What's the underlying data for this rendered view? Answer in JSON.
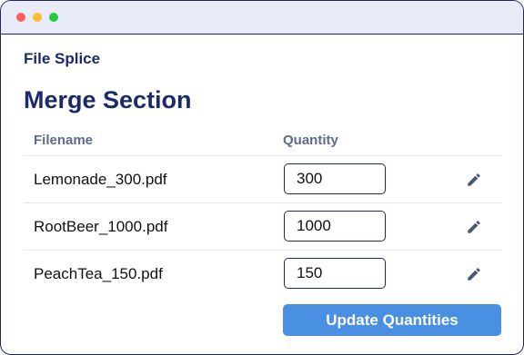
{
  "window": {
    "controls": [
      "close",
      "minimize",
      "maximize"
    ]
  },
  "app": {
    "title": "File Splice"
  },
  "section": {
    "title": "Merge Section"
  },
  "table": {
    "columns": {
      "filename": "Filename",
      "quantity": "Quantity"
    },
    "rows": [
      {
        "filename": "Lemonade_300.pdf",
        "quantity": "300",
        "action_icon": "pencil-icon"
      },
      {
        "filename": "RootBeer_1000.pdf",
        "quantity": "1000",
        "action_icon": "pencil-icon"
      },
      {
        "filename": "PeachTea_150.pdf",
        "quantity": "150",
        "action_icon": "pencil-icon"
      }
    ]
  },
  "actions": {
    "update_label": "Update Quantities"
  },
  "colors": {
    "accent": "#4a90e2",
    "heading": "#1b2a6b",
    "muted": "#5d6c8e",
    "border": "#1f2a5a",
    "titlebar": "#e9ecf8",
    "close": "#ff5f57",
    "minimize": "#ffbd2e",
    "maximize": "#28c940"
  }
}
